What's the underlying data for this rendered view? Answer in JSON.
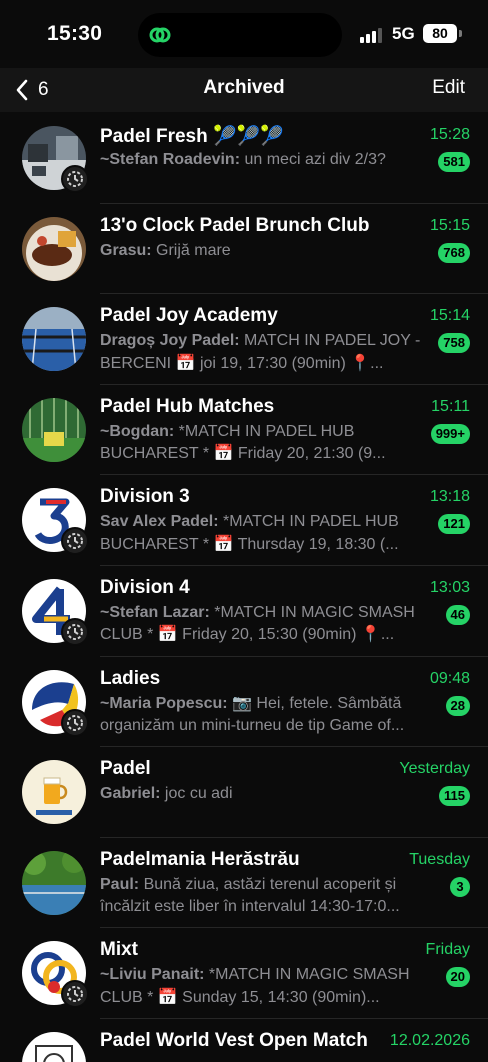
{
  "status_bar": {
    "time": "15:30",
    "network": "5G",
    "battery": "80"
  },
  "nav": {
    "back_count": "6",
    "title": "Archived",
    "edit_label": "Edit"
  },
  "chats": [
    {
      "name": "Padel Fresh 🎾🎾🎾",
      "sender": "~Stefan Roadevin:",
      "message": " un meci azi div 2/3?",
      "time": "15:28",
      "unread": "581",
      "community": true,
      "avatar": "indoor-court"
    },
    {
      "name": "13'o Clock Padel Brunch Club",
      "sender": "Grasu:",
      "message": " Grijă mare",
      "time": "15:15",
      "unread": "768",
      "community": false,
      "avatar": "food-plate"
    },
    {
      "name": "Padel Joy Academy",
      "sender": "Dragoș Joy Padel:",
      "message": " MATCH IN PADEL JOY - BERCENI 📅 joi 19, 17:30 (90min) 📍...",
      "time": "15:14",
      "unread": "758",
      "community": false,
      "avatar": "padel-court"
    },
    {
      "name": "Padel Hub Matches",
      "sender": "~Bogdan:",
      "message": " *MATCH IN PADEL HUB BUCHAREST * 📅 Friday 20, 21:30 (9...",
      "time": "15:11",
      "unread": "999+",
      "community": false,
      "avatar": "green-court"
    },
    {
      "name": "Division 3",
      "sender": "Sav Alex Padel:",
      "message": " *MATCH IN PADEL HUB BUCHAREST * 📅 Thursday 19, 18:30 (...",
      "time": "13:18",
      "unread": "121",
      "community": true,
      "avatar": "number-3"
    },
    {
      "name": "Division 4",
      "sender": "~Stefan Lazar:",
      "message": " *MATCH IN MAGIC SMASH CLUB * 📅 Friday 20, 15:30 (90min) 📍...",
      "time": "13:03",
      "unread": "46",
      "community": true,
      "avatar": "number-4"
    },
    {
      "name": "Ladies",
      "sender": "~Maria Popescu:",
      "message": " 📷 Hei, fetele. Sâmbătă organizăm un mini-turneu de tip Game of...",
      "time": "09:48",
      "unread": "28",
      "community": true,
      "avatar": "tricolor-ball"
    },
    {
      "name": "Padel",
      "sender": "Gabriel:",
      "message": " joc cu adi",
      "time": "Yesterday",
      "unread": "115",
      "community": false,
      "avatar": "beer-logo"
    },
    {
      "name": "Padelmania Herăstrău",
      "sender": "Paul:",
      "message": " Bună ziua, astăzi terenul acoperit și încălzit este liber în intervalul 14:30-17:0...",
      "time": "Tuesday",
      "unread": "3",
      "community": false,
      "avatar": "outdoor-court"
    },
    {
      "name": "Mixt",
      "sender": "~Liviu Panait:",
      "message": " *MATCH IN MAGIC SMASH CLUB * 📅 Sunday 15, 14:30 (90min)...",
      "time": "Friday",
      "unread": "20",
      "community": true,
      "avatar": "mixt-logo"
    },
    {
      "name": "Padel World Vest Open Match",
      "sender": "",
      "message": "",
      "time": "12.02.2026",
      "unread": "",
      "community": false,
      "avatar": "tennis-logo"
    }
  ],
  "colors": {
    "accent": "#25d366",
    "background": "#0b0b0b",
    "secondary_text": "#8e8e93"
  }
}
